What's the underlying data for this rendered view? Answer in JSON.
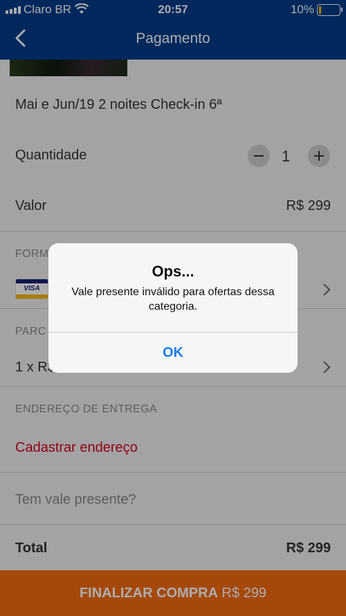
{
  "status_bar": {
    "carrier": "Claro BR",
    "time": "20:57",
    "battery": "10%",
    "battery_level": 0.1,
    "signal_icon": "signal-bars-icon",
    "wifi_icon": "wifi-icon"
  },
  "header": {
    "title": "Pagamento",
    "back_icon": "chevron-left-icon",
    "color": "#003c8a"
  },
  "offer": {
    "description": "Mai e Jun/19 2 noites Check-in 6ª"
  },
  "quantity": {
    "label": "Quantidade",
    "value": "1",
    "minus_symbol": "−",
    "plus_symbol": "+"
  },
  "price": {
    "label": "Valor",
    "value": "R$ 299"
  },
  "payment": {
    "section_label": "FORM",
    "card_brand": "VISA"
  },
  "installments": {
    "section_label": "PARC",
    "value": "1 x R$"
  },
  "address": {
    "section_label": "ENDEREÇO DE ENTREGA",
    "link": "Cadastrar endereço"
  },
  "gift": {
    "placeholder": "Tem vale presente?"
  },
  "total": {
    "label": "Total",
    "value": "R$ 299"
  },
  "checkout": {
    "label": "FINALIZAR COMPRA",
    "amount": "R$ 299",
    "color": "#f36a10"
  },
  "alert": {
    "title": "Ops...",
    "message": "Vale presente inválido para ofertas dessa categoria.",
    "ok": "OK"
  }
}
